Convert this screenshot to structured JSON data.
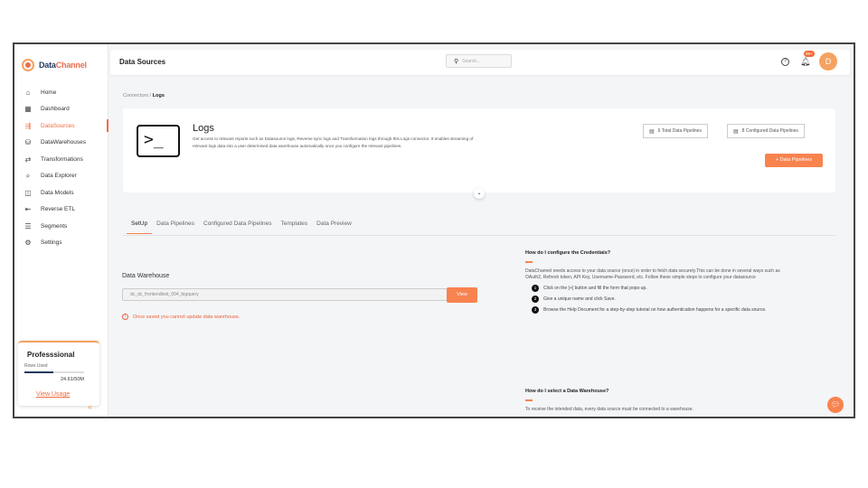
{
  "brand": {
    "name_part1": "Data",
    "name_part2": "Channel"
  },
  "sidebar": {
    "items": [
      {
        "label": "Home",
        "icon": "home-icon",
        "glyph": "⌂"
      },
      {
        "label": "Dashboard",
        "icon": "dashboard-icon",
        "glyph": "▦"
      },
      {
        "label": "DataSources",
        "icon": "datasources-icon",
        "glyph": "⇶"
      },
      {
        "label": "DataWarehouses",
        "icon": "warehouse-icon",
        "glyph": "⛁"
      },
      {
        "label": "Transformations",
        "icon": "transform-icon",
        "glyph": "⇄"
      },
      {
        "label": "Data Explorer",
        "icon": "explorer-icon",
        "glyph": "⌕"
      },
      {
        "label": "Data Models",
        "icon": "models-icon",
        "glyph": "◫"
      },
      {
        "label": "Reverse ETL",
        "icon": "reverse-etl-icon",
        "glyph": "⇤"
      },
      {
        "label": "Segments",
        "icon": "segments-icon",
        "glyph": "☰"
      },
      {
        "label": "Settings",
        "icon": "settings-icon",
        "glyph": "⚙"
      }
    ],
    "active_index": 2,
    "plan": {
      "title": "Professsional",
      "rows_label": "Rows Used",
      "usage": "24.61/50M",
      "usage_fraction": 0.49,
      "link": "View Usage"
    },
    "collapse_glyph": "«"
  },
  "header": {
    "title": "Data Sources",
    "search_placeholder": "Search...",
    "notification_badge": "99+",
    "avatar_initial": "D"
  },
  "breadcrumb": {
    "parent": "Connectors",
    "separator": "/",
    "current": "Logs"
  },
  "connector": {
    "title": "Logs",
    "description": "Get access to relevant reports such as Datasource logs, Reverse sync logs and Transformation logs through this Logs connector. It enables streaming of relevant logs data into a user determined data warehouse automatically once you configure the relevant pipelines.",
    "total_pipelines": "6 Total Data Pipelines",
    "configured_pipelines": "8 Configured Data Pipelines",
    "add_button": "+ Data Pipelines"
  },
  "tabs": [
    "SetUp",
    "Data Pipelines",
    "Configured Data Pipelines",
    "Templates",
    "Data Preview"
  ],
  "setup": {
    "warehouse_label": "Data Warehouse",
    "warehouse_value": "dc_dc_frontendtest_004_bigquery",
    "view_button": "View",
    "warning": "Once saved you cannot update data warehouse."
  },
  "help": {
    "q1_title": "How do I configure the Credentials?",
    "q1_text": "DataChannel needs access to your data source (once) in order to fetch data securely.This can be done in several ways such as OAuth2, Refresh token, API Key, Username-Password, etc. Follow these simple steps to configure your datasource",
    "steps": [
      "Click on the [+] button and fill the form that pops-up.",
      "Give a unique name and click Save.",
      "Browse the Help Document for a step-by-step tutorial on how authentication happens for a specific data source."
    ],
    "q2_title": "How do I select a Data Warehouse?",
    "q2_text": "To receive the intended data, every data source must be connected to a warehouse."
  },
  "colors": {
    "accent": "#f8834f",
    "brand_navy": "#1f3a5f"
  }
}
